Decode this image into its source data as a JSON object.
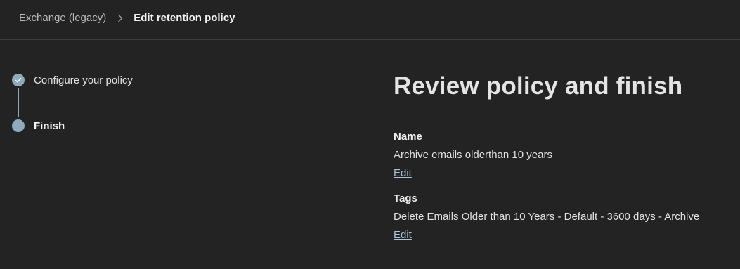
{
  "breadcrumb": {
    "parent": "Exchange (legacy)",
    "current": "Edit retention policy"
  },
  "icons": {
    "separator": "chevron-right-icon",
    "step_complete": "check-icon"
  },
  "colors": {
    "background": "#232323",
    "step_accent": "#8fa9bd",
    "link": "#a9c3db"
  },
  "steps": [
    {
      "label": "Configure your policy",
      "status": "completed"
    },
    {
      "label": "Finish",
      "status": "current"
    }
  ],
  "main": {
    "title": "Review policy and finish",
    "sections": [
      {
        "label": "Name",
        "value": "Archive emails olderthan 10 years",
        "edit_label": "Edit"
      },
      {
        "label": "Tags",
        "value": "Delete Emails Older than 10 Years - Default - 3600 days - Archive",
        "edit_label": "Edit"
      }
    ]
  }
}
